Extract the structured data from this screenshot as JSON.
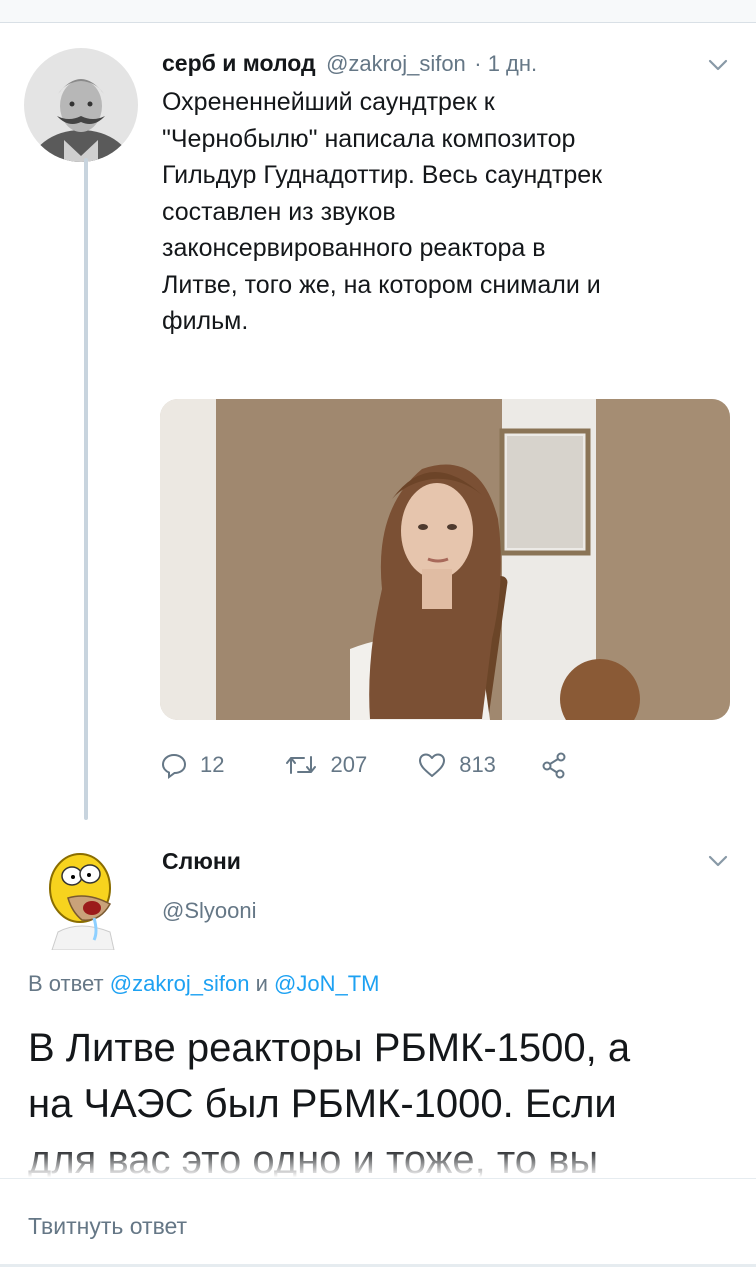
{
  "tweet": {
    "author_name": "серб и молод",
    "author_handle": "@zakroj_sifon",
    "time": "· 1 дн.",
    "text": "Охрененнейший саундтрек к\n\"Чернобылю\" написала композитор\nГильдур Гуднадоттир. Весь саундтрек\nсоставлен из звуков\nзаконсервированного реактора в\nЛитве, того же, на котором снимали и\nфильм.",
    "replies": "12",
    "retweets": "207",
    "likes": "813"
  },
  "reply": {
    "author_name": "Слюни",
    "author_handle": "@Slyooni",
    "reply_prefix": "В ответ",
    "reply_user1": "@zakroj_sifon",
    "reply_and": "и",
    "reply_user2": "@JoN_TM",
    "text": "В Литве реакторы РБМК-1500, а\nна ЧАЭС был РБМК-1000. Если\nдля вас это одно и тоже, то вы"
  },
  "composer": {
    "placeholder": "Твитнуть ответ"
  },
  "icons": {
    "reply": "reply-icon",
    "retweet": "retweet-icon",
    "like": "heart-icon",
    "share": "share-icon",
    "menu": "chevron-down-icon"
  },
  "colors": {
    "link": "#1da1f2",
    "secondary_text": "#657786",
    "thread_line": "#c8d4de"
  }
}
